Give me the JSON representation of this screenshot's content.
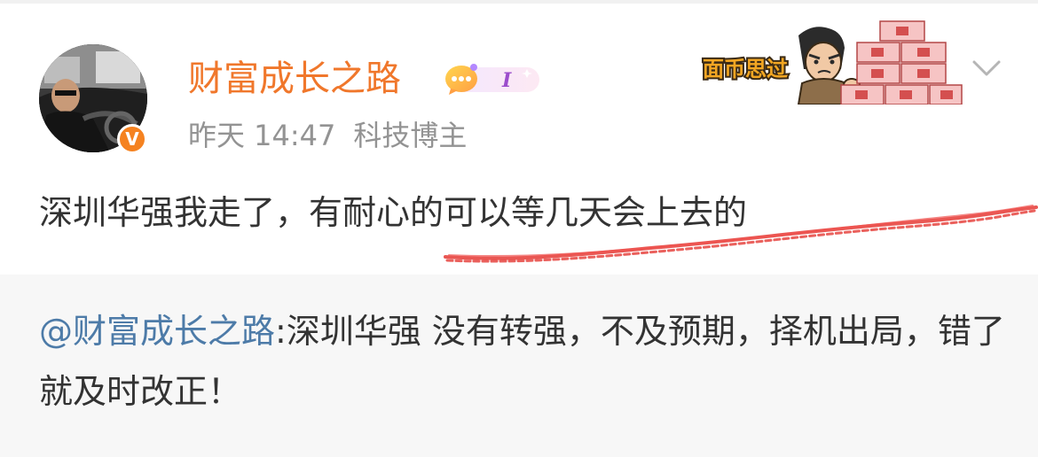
{
  "post": {
    "username": "财富成长之路",
    "member_badge_icon": "vip-chat-bubble-icon",
    "member_badge_level": "I",
    "verified_icon": "verified-orange-v-icon",
    "verified_label": "V",
    "timestamp": "昨天 14:47",
    "source": "科技博主",
    "sticker_caption": "面币思过",
    "sticker_icon": "money-stack-sticker-icon",
    "menu_icon": "chevron-down-icon",
    "text": "深圳华强我走了，有耐心的可以等几天会上去的",
    "annotation": "red-hand-drawn-underline"
  },
  "repost": {
    "mention": "@财富成长之路",
    "separator": ":",
    "text": "深圳华强 没有转强，不及预期，择机出局，错了就及时改正！"
  },
  "colors": {
    "username": "#f0772b",
    "mention": "#4d7ba8",
    "meta": "#939393",
    "body_text": "#333333",
    "repost_background": "#f7f7f7",
    "verified_badge": "#f58220",
    "scribble": "#e53935"
  }
}
